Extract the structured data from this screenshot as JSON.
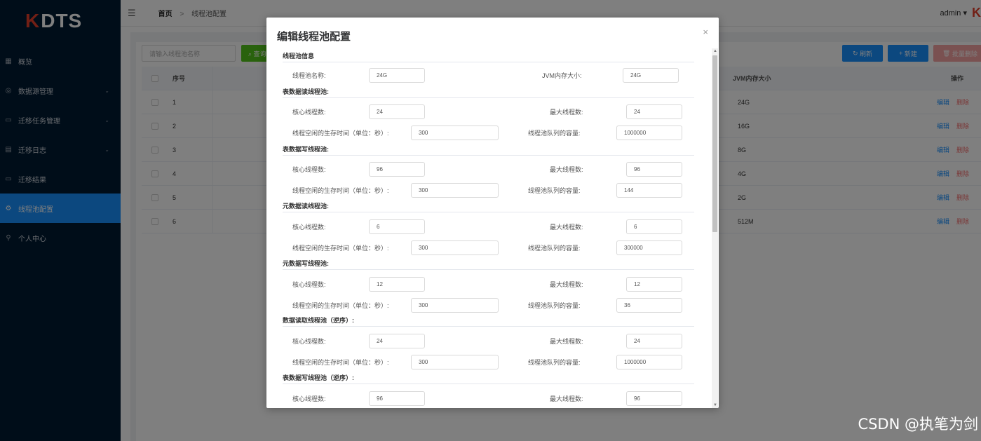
{
  "app": {
    "logo_k": "K",
    "logo_text": "DTS",
    "user": "admin ▾",
    "user_logo": "K"
  },
  "sidebar": {
    "items": [
      {
        "label": "概览",
        "icon": "grid-icon"
      },
      {
        "label": "数据源管理",
        "icon": "database-icon",
        "expandable": true
      },
      {
        "label": "迁移任务管理",
        "icon": "folder-icon",
        "expandable": true
      },
      {
        "label": "迁移日志",
        "icon": "document-icon",
        "expandable": true
      },
      {
        "label": "迁移结果",
        "icon": "check-folder-icon"
      },
      {
        "label": "线程池配置",
        "icon": "gear-icon",
        "active": true
      },
      {
        "label": "个人中心",
        "icon": "user-icon"
      }
    ]
  },
  "breadcrumb": {
    "home": "首页",
    "current": "线程池配置"
  },
  "toolbar": {
    "search_placeholder": "请输入线程池名称",
    "search_btn": "查询",
    "refresh_btn": "刷新",
    "new_btn": "新建",
    "batch_delete_btn": "批量删除"
  },
  "table": {
    "headers": {
      "no": "序号",
      "jvm": "JVM内存大小",
      "op": "操作"
    },
    "edit": "编辑",
    "delete": "删除",
    "rows": [
      {
        "no": "1",
        "jvm": "24G"
      },
      {
        "no": "2",
        "jvm": "16G"
      },
      {
        "no": "3",
        "jvm": "8G"
      },
      {
        "no": "4",
        "jvm": "4G"
      },
      {
        "no": "5",
        "jvm": "2G"
      },
      {
        "no": "6",
        "jvm": "512M"
      }
    ]
  },
  "modal": {
    "title": "编辑线程池配置",
    "close": "×",
    "info": {
      "section": "线程池信息",
      "name_label": "线程池名称:",
      "name_value": "24G",
      "jvm_label": "JVM内存大小:",
      "jvm_value": "24G"
    },
    "labels": {
      "core": "核心线程数:",
      "max": "最大线程数:",
      "idle": "线程空闲的生存时间（单位：秒）:",
      "queue": "线程池队列的容量:"
    },
    "pools": [
      {
        "section": "表数据读线程池:",
        "core": "24",
        "max": "24",
        "idle": "300",
        "queue": "1000000"
      },
      {
        "section": "表数据写线程池:",
        "core": "96",
        "max": "96",
        "idle": "300",
        "queue": "144"
      },
      {
        "section": "元数据读线程池:",
        "core": "6",
        "max": "6",
        "idle": "300",
        "queue": "300000"
      },
      {
        "section": "元数据写线程池:",
        "core": "12",
        "max": "12",
        "idle": "300",
        "queue": "36"
      },
      {
        "section": "数据读取线程池（逆序）:",
        "core": "24",
        "max": "24",
        "idle": "300",
        "queue": "1000000"
      },
      {
        "section": "表数据写线程池（逆序）:",
        "core": "96",
        "max": "96"
      }
    ]
  },
  "watermark": "CSDN @执笔为剑"
}
